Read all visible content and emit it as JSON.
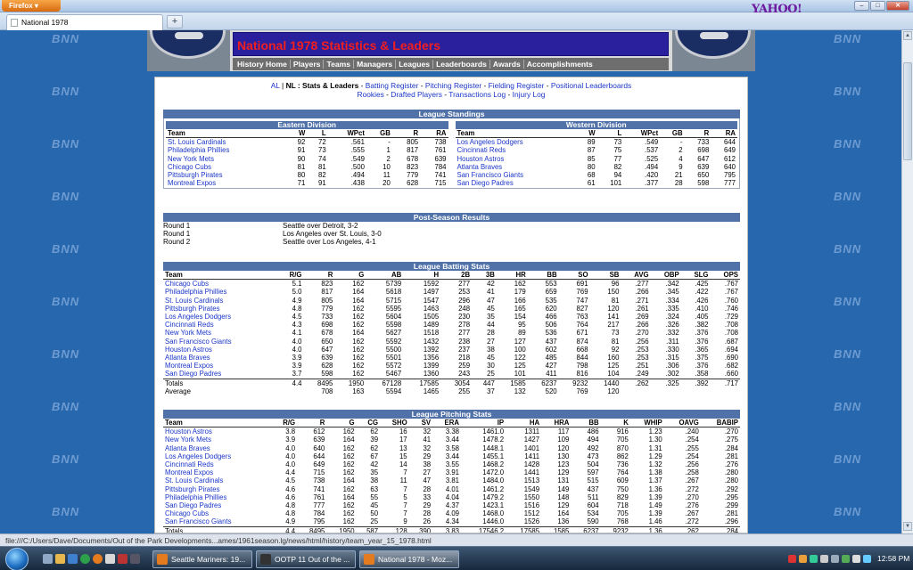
{
  "browser": {
    "menu_label": "Firefox",
    "tab_title": "National 1978",
    "new_tab_symbol": "+",
    "search_logo": "YAHOO!",
    "status_url": "file:///C:/Users/Dave/Documents/Out of the Park Developments...ames/1961season.lg/news/html/history/team_year_15_1978.html"
  },
  "background_watermark": "BNN",
  "header": {
    "title": "National 1978 Statistics & Leaders",
    "nav": [
      "History Home",
      "Players",
      "Teams",
      "Managers",
      "Leagues",
      "Leaderboards",
      "Awards",
      "Accomplishments"
    ]
  },
  "subnav": {
    "al": "AL",
    "sep1": " | ",
    "nl": "NL : Stats & Leaders",
    "sep2": " - ",
    "links_line1": [
      "Batting Register",
      "Pitching Register",
      "Fielding Register",
      "Positional Leaderboards"
    ],
    "links_line2": [
      "Rookies",
      "Drafted Players",
      "Transactions Log",
      "Injury Log"
    ]
  },
  "standings": {
    "title": "League Standings",
    "columns": [
      "Team",
      "W",
      "L",
      "WPct",
      "GB",
      "R",
      "RA"
    ],
    "east": {
      "name": "Eastern Division",
      "rows": [
        [
          "St. Louis Cardinals",
          "92",
          "72",
          ".561",
          "-",
          "805",
          "738"
        ],
        [
          "Philadelphia Phillies",
          "91",
          "73",
          ".555",
          "1",
          "817",
          "761"
        ],
        [
          "New York Mets",
          "90",
          "74",
          ".549",
          "2",
          "678",
          "639"
        ],
        [
          "Chicago Cubs",
          "81",
          "81",
          ".500",
          "10",
          "823",
          "784"
        ],
        [
          "Pittsburgh Pirates",
          "80",
          "82",
          ".494",
          "11",
          "779",
          "741"
        ],
        [
          "Montreal Expos",
          "71",
          "91",
          ".438",
          "20",
          "628",
          "715"
        ]
      ]
    },
    "west": {
      "name": "Western Division",
      "rows": [
        [
          "Los Angeles Dodgers",
          "89",
          "73",
          ".549",
          "-",
          "733",
          "644"
        ],
        [
          "Cincinnati Reds",
          "87",
          "75",
          ".537",
          "2",
          "698",
          "649"
        ],
        [
          "Houston Astros",
          "85",
          "77",
          ".525",
          "4",
          "647",
          "612"
        ],
        [
          "Atlanta Braves",
          "80",
          "82",
          ".494",
          "9",
          "639",
          "640"
        ],
        [
          "San Francisco Giants",
          "68",
          "94",
          ".420",
          "21",
          "650",
          "795"
        ],
        [
          "San Diego Padres",
          "61",
          "101",
          ".377",
          "28",
          "598",
          "777"
        ]
      ]
    }
  },
  "postseason": {
    "title": "Post-Season Results",
    "rows": [
      [
        "Round 1",
        "Seattle over Detroit, 3-2"
      ],
      [
        "Round 1",
        "Los Angeles over St. Louis, 3-0"
      ],
      [
        "Round 2",
        "Seattle over Los Angeles, 4-1"
      ]
    ]
  },
  "batting": {
    "title": "League Batting Stats",
    "columns": [
      "Team",
      "R/G",
      "R",
      "G",
      "AB",
      "H",
      "2B",
      "3B",
      "HR",
      "BB",
      "SO",
      "SB",
      "AVG",
      "OBP",
      "SLG",
      "OPS"
    ],
    "rows": [
      [
        "Chicago Cubs",
        "5.1",
        "823",
        "162",
        "5739",
        "1592",
        "277",
        "42",
        "162",
        "553",
        "691",
        "96",
        ".277",
        ".342",
        ".425",
        ".767"
      ],
      [
        "Philadelphia Phillies",
        "5.0",
        "817",
        "164",
        "5618",
        "1497",
        "253",
        "41",
        "179",
        "659",
        "769",
        "150",
        ".266",
        ".345",
        ".422",
        ".767"
      ],
      [
        "St. Louis Cardinals",
        "4.9",
        "805",
        "164",
        "5715",
        "1547",
        "296",
        "47",
        "166",
        "535",
        "747",
        "81",
        ".271",
        ".334",
        ".426",
        ".760"
      ],
      [
        "Pittsburgh Pirates",
        "4.8",
        "779",
        "162",
        "5595",
        "1463",
        "248",
        "45",
        "165",
        "620",
        "827",
        "120",
        ".261",
        ".335",
        ".410",
        ".746"
      ],
      [
        "Los Angeles Dodgers",
        "4.5",
        "733",
        "162",
        "5604",
        "1505",
        "230",
        "35",
        "154",
        "466",
        "763",
        "141",
        ".269",
        ".324",
        ".405",
        ".729"
      ],
      [
        "Cincinnati Reds",
        "4.3",
        "698",
        "162",
        "5598",
        "1489",
        "278",
        "44",
        "95",
        "506",
        "764",
        "217",
        ".266",
        ".326",
        ".382",
        ".708"
      ],
      [
        "New York Mets",
        "4.1",
        "678",
        "164",
        "5627",
        "1518",
        "277",
        "28",
        "89",
        "536",
        "671",
        "73",
        ".270",
        ".332",
        ".376",
        ".708"
      ],
      [
        "San Francisco Giants",
        "4.0",
        "650",
        "162",
        "5592",
        "1432",
        "238",
        "27",
        "127",
        "437",
        "874",
        "81",
        ".256",
        ".311",
        ".376",
        ".687"
      ],
      [
        "Houston Astros",
        "4.0",
        "647",
        "162",
        "5500",
        "1392",
        "237",
        "38",
        "100",
        "602",
        "668",
        "92",
        ".253",
        ".330",
        ".365",
        ".694"
      ],
      [
        "Atlanta Braves",
        "3.9",
        "639",
        "162",
        "5501",
        "1356",
        "218",
        "45",
        "122",
        "485",
        "844",
        "160",
        ".253",
        ".315",
        ".375",
        ".690"
      ],
      [
        "Montreal Expos",
        "3.9",
        "628",
        "162",
        "5572",
        "1399",
        "259",
        "30",
        "125",
        "427",
        "798",
        "125",
        ".251",
        ".306",
        ".376",
        ".682"
      ],
      [
        "San Diego Padres",
        "3.7",
        "598",
        "162",
        "5467",
        "1360",
        "243",
        "25",
        "101",
        "411",
        "816",
        "104",
        ".249",
        ".302",
        ".358",
        ".660"
      ]
    ],
    "totals": [
      "Totals",
      "4.4",
      "8495",
      "1950",
      "67128",
      "17585",
      "3054",
      "447",
      "1585",
      "6237",
      "9232",
      "1440",
      ".262",
      ".325",
      ".392",
      ".717"
    ],
    "average": [
      "Average",
      "",
      "708",
      "163",
      "5594",
      "1465",
      "255",
      "37",
      "132",
      "520",
      "769",
      "120",
      "",
      "",
      "",
      ""
    ]
  },
  "pitching": {
    "title": "League Pitching Stats",
    "columns": [
      "Team",
      "R/G",
      "R",
      "G",
      "CG",
      "SHO",
      "SV",
      "ERA",
      "IP",
      "HA",
      "HRA",
      "BB",
      "K",
      "WHIP",
      "OAVG",
      "BABIP"
    ],
    "rows": [
      [
        "Houston Astros",
        "3.8",
        "612",
        "162",
        "62",
        "16",
        "32",
        "3.38",
        "1461.0",
        "1311",
        "117",
        "486",
        "916",
        "1.23",
        ".240",
        ".270"
      ],
      [
        "New York Mets",
        "3.9",
        "639",
        "164",
        "39",
        "17",
        "41",
        "3.44",
        "1478.2",
        "1427",
        "109",
        "494",
        "705",
        "1.30",
        ".254",
        ".275"
      ],
      [
        "Atlanta Braves",
        "4.0",
        "640",
        "162",
        "62",
        "13",
        "32",
        "3.58",
        "1448.1",
        "1401",
        "120",
        "492",
        "870",
        "1.31",
        ".255",
        ".284"
      ],
      [
        "Los Angeles Dodgers",
        "4.0",
        "644",
        "162",
        "67",
        "15",
        "29",
        "3.44",
        "1455.1",
        "1411",
        "130",
        "473",
        "862",
        "1.29",
        ".254",
        ".281"
      ],
      [
        "Cincinnati Reds",
        "4.0",
        "649",
        "162",
        "42",
        "14",
        "38",
        "3.55",
        "1468.2",
        "1428",
        "123",
        "504",
        "736",
        "1.32",
        ".256",
        ".276"
      ],
      [
        "Montreal Expos",
        "4.4",
        "715",
        "162",
        "35",
        "7",
        "27",
        "3.91",
        "1472.0",
        "1441",
        "129",
        "597",
        "764",
        "1.38",
        ".258",
        ".280"
      ],
      [
        "St. Louis Cardinals",
        "4.5",
        "738",
        "164",
        "38",
        "11",
        "47",
        "3.81",
        "1484.0",
        "1513",
        "131",
        "515",
        "609",
        "1.37",
        ".267",
        ".280"
      ],
      [
        "Pittsburgh Pirates",
        "4.6",
        "741",
        "162",
        "63",
        "7",
        "28",
        "4.01",
        "1461.2",
        "1549",
        "149",
        "437",
        "750",
        "1.36",
        ".272",
        ".292"
      ],
      [
        "Philadelphia Phillies",
        "4.6",
        "761",
        "164",
        "55",
        "5",
        "33",
        "4.04",
        "1479.2",
        "1550",
        "148",
        "511",
        "829",
        "1.39",
        ".270",
        ".295"
      ],
      [
        "San Diego Padres",
        "4.8",
        "777",
        "162",
        "45",
        "7",
        "29",
        "4.37",
        "1423.1",
        "1516",
        "129",
        "604",
        "718",
        "1.49",
        ".276",
        ".299"
      ],
      [
        "Chicago Cubs",
        "4.8",
        "784",
        "162",
        "50",
        "7",
        "28",
        "4.09",
        "1468.0",
        "1512",
        "164",
        "534",
        "705",
        "1.39",
        ".267",
        ".281"
      ],
      [
        "San Francisco Giants",
        "4.9",
        "795",
        "162",
        "25",
        "9",
        "26",
        "4.34",
        "1446.0",
        "1526",
        "136",
        "590",
        "768",
        "1.46",
        ".272",
        ".296"
      ]
    ],
    "totals": [
      "Totals",
      "4.4",
      "8495",
      "1950",
      "587",
      "128",
      "390",
      "3.83",
      "17546.2",
      "17585",
      "1585",
      "6237",
      "9232",
      "1.36",
      ".262",
      ".284"
    ],
    "average": [
      "Average",
      "",
      "",
      "",
      "",
      "",
      "",
      "",
      "1462",
      "1465",
      "132",
      "520",
      "769",
      "",
      "",
      ""
    ]
  },
  "taskbar": {
    "tasks": [
      "Seattle Mariners: 19...",
      "OOTP 11 Out of the ...",
      "National 1978 - Moz..."
    ],
    "clock": "12:58 PM"
  }
}
